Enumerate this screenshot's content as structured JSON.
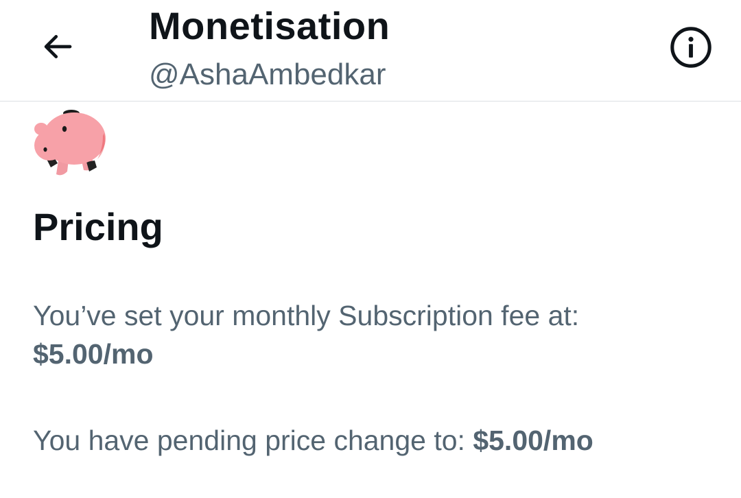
{
  "header": {
    "title": "Monetisation",
    "handle": "@AshaAmbedkar",
    "back_icon": "arrow-left-icon",
    "info_icon": "info-circle-icon"
  },
  "hero_icon": "piggy-bank-icon",
  "pricing": {
    "heading": "Pricing",
    "fee_text": "You’ve set your monthly Subscription fee at:",
    "fee_amount": "$5.00/mo",
    "pending_text": "You have pending price change to: ",
    "pending_amount": "$5.00/mo"
  },
  "colors": {
    "primary_text": "#0f1419",
    "secondary_text": "#536471",
    "pig_pink": "#f7a1a8",
    "divider": "#dcdfe3"
  }
}
